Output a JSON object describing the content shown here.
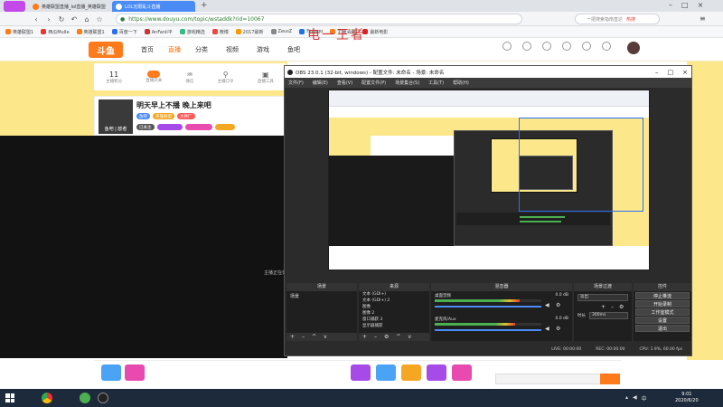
{
  "browser": {
    "tabs": [
      {
        "label": "英雄联盟直播_lol直播_英雄联盟",
        "active": false
      },
      {
        "label": "LOL无限乱斗直播",
        "active": true
      }
    ],
    "new_tab_label": "+",
    "url": "https://www.douyu.com/topic/wstaddk?rid=10067",
    "search_placeholder": "一把搜索指南直达",
    "search_hot_label": "热搜",
    "bookmarks": [
      "英雄联盟1",
      "西瓜Mulle",
      "英雄联盟1",
      "百度一下",
      "AnFanli平",
      "游戏精选",
      "微博",
      "",
      "2017最新",
      "",
      "",
      "ZeusZ",
      "Fapago",
      "主播清服",
      "最新电影"
    ]
  },
  "douyu": {
    "logo": "斗鱼",
    "nav": [
      "首页",
      "直播",
      "分类",
      "视频",
      "游戏",
      "鱼吧"
    ],
    "nav_active_index": 1,
    "watermark": "电一王者",
    "room": {
      "title": "明天早上不播 晚上来吧",
      "streamer_tag": "鱼吧",
      "category_labels": [
        "英雄联盟",
        "大神厂"
      ],
      "follow_label": "已关注",
      "avatar_caption": "鱼吧 | 欧者"
    },
    "sub_icons": [
      "主播积分",
      "直播开关",
      "微信",
      "主播口令",
      "直播工具"
    ],
    "level_badge": "11",
    "status_text": "主播正在休息"
  },
  "obs": {
    "title": "OBS 23.0.1 (32-bit, windows) - 配置文件: 未命名 - 场景: 未命名",
    "menu": [
      "文件(F)",
      "编辑(E)",
      "查看(V)",
      "配置文件(P)",
      "场景集合(S)",
      "工具(T)",
      "帮助(H)"
    ],
    "docks": {
      "scenes": {
        "title": "场景",
        "items": [
          "场景"
        ]
      },
      "sources": {
        "title": "来源",
        "items": [
          "文本 (GDI+)",
          "文本 (GDI+) 2",
          "图像",
          "图像 2",
          "窗口捕获 3",
          "显示器捕获"
        ]
      },
      "mixer": {
        "title": "混音器",
        "channels": [
          {
            "name": "桌面音频",
            "db": "0.0 dB",
            "level": 0.8
          },
          {
            "name": "麦克风/Aux",
            "db": "0.0 dB",
            "level": 0.75
          }
        ]
      },
      "transitions": {
        "title": "场景过渡",
        "type": "淡出",
        "duration_label": "时长",
        "duration": "300ms"
      },
      "controls": {
        "title": "控件",
        "buttons": [
          "停止推流",
          "开始录制",
          "工作室模式",
          "设置",
          "退出"
        ]
      }
    },
    "status": {
      "live": "LIVE: 00:00:00",
      "rec": "REC: 00:00:00",
      "cpu": "CPU: 1.9%, 60.00 fps"
    }
  },
  "taskbar": {
    "time": "9:01",
    "date": "2020/6/20",
    "lang": "中"
  }
}
